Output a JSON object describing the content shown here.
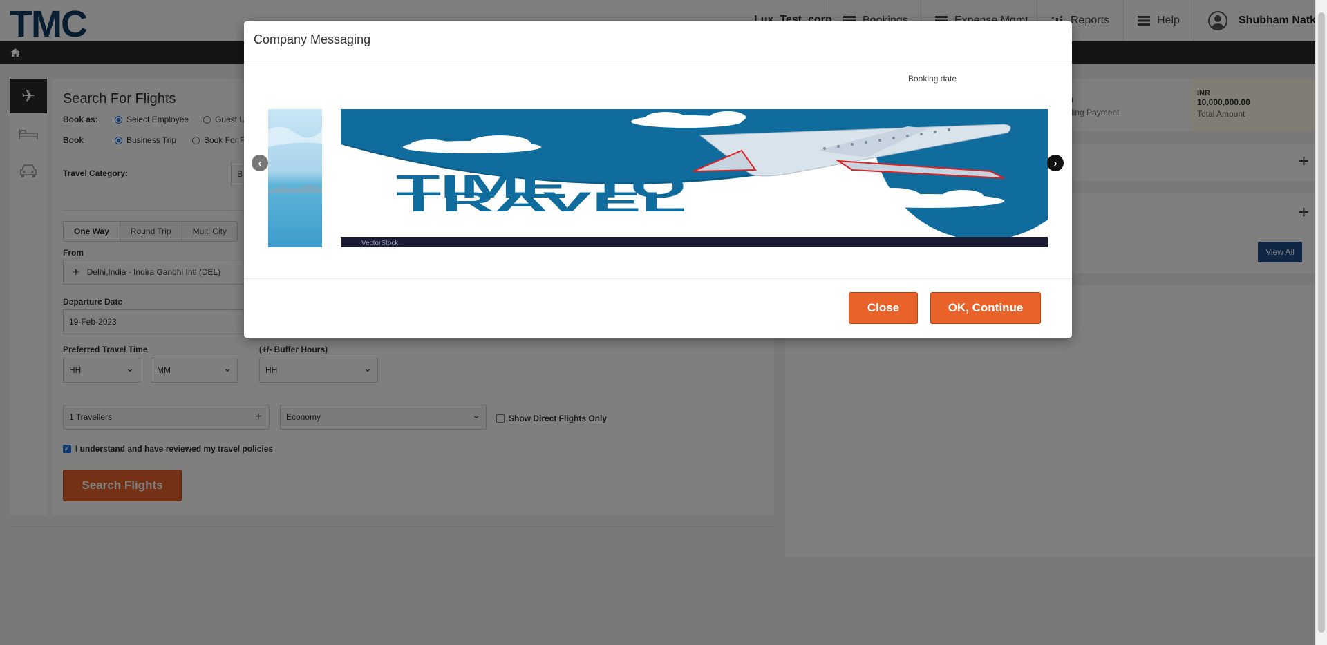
{
  "header": {
    "logo": "TMC",
    "corp": "Lux_Test_corp",
    "nav": [
      {
        "label": "Bookings",
        "icon": "menu-icon"
      },
      {
        "label": "Expense Mgmt",
        "icon": "menu-icon"
      },
      {
        "label": "Reports",
        "icon": "reports-icon"
      },
      {
        "label": "Help",
        "icon": "menu-icon"
      }
    ],
    "user": "Shubham Natkar"
  },
  "search": {
    "title": "Search For Flights",
    "book_as_label": "Book as:",
    "book_as_options": [
      "Select Employee",
      "Guest U"
    ],
    "book_label": "Book",
    "book_options": [
      "Business Trip",
      "Book For F"
    ],
    "travel_category_label": "Travel Category:",
    "travel_category_value": "B",
    "trip_tabs": [
      "One Way",
      "Round Trip",
      "Multi City"
    ],
    "from_label": "From",
    "from_value": "Delhi,India - Indira Gandhi Intl (DEL)",
    "departure_label": "Departure Date",
    "departure_value": "19-Feb-2023",
    "pref_time_label": "Preferred Travel Time",
    "buffer_label": "(+/- Buffer Hours)",
    "hh": "HH",
    "mm": "MM",
    "buffer_hh": "HH",
    "travellers": "1 Travellers",
    "cabin": "Economy",
    "direct_only": "Show Direct Flights Only",
    "policy": "I understand and have reviewed my travel policies",
    "search_button": "Search Flights"
  },
  "stats": {
    "pending_value": "0",
    "pending_label": "ding Payment",
    "currency": "INR",
    "total_value": "10,000,000.00",
    "total_label": "Total Amount"
  },
  "view_all": "View All",
  "modal": {
    "title": "Company Messaging",
    "booking_date": "Booking date",
    "banner_text_line1": "TIME TO",
    "banner_text_line2": "TRAVEL",
    "watermark": "VectorStock",
    "close_button": "Close",
    "ok_button": "OK, Continue"
  },
  "colors": {
    "accent": "#e8622a",
    "navy": "#0e3a64",
    "banner_blue": "#0f6c9c"
  }
}
